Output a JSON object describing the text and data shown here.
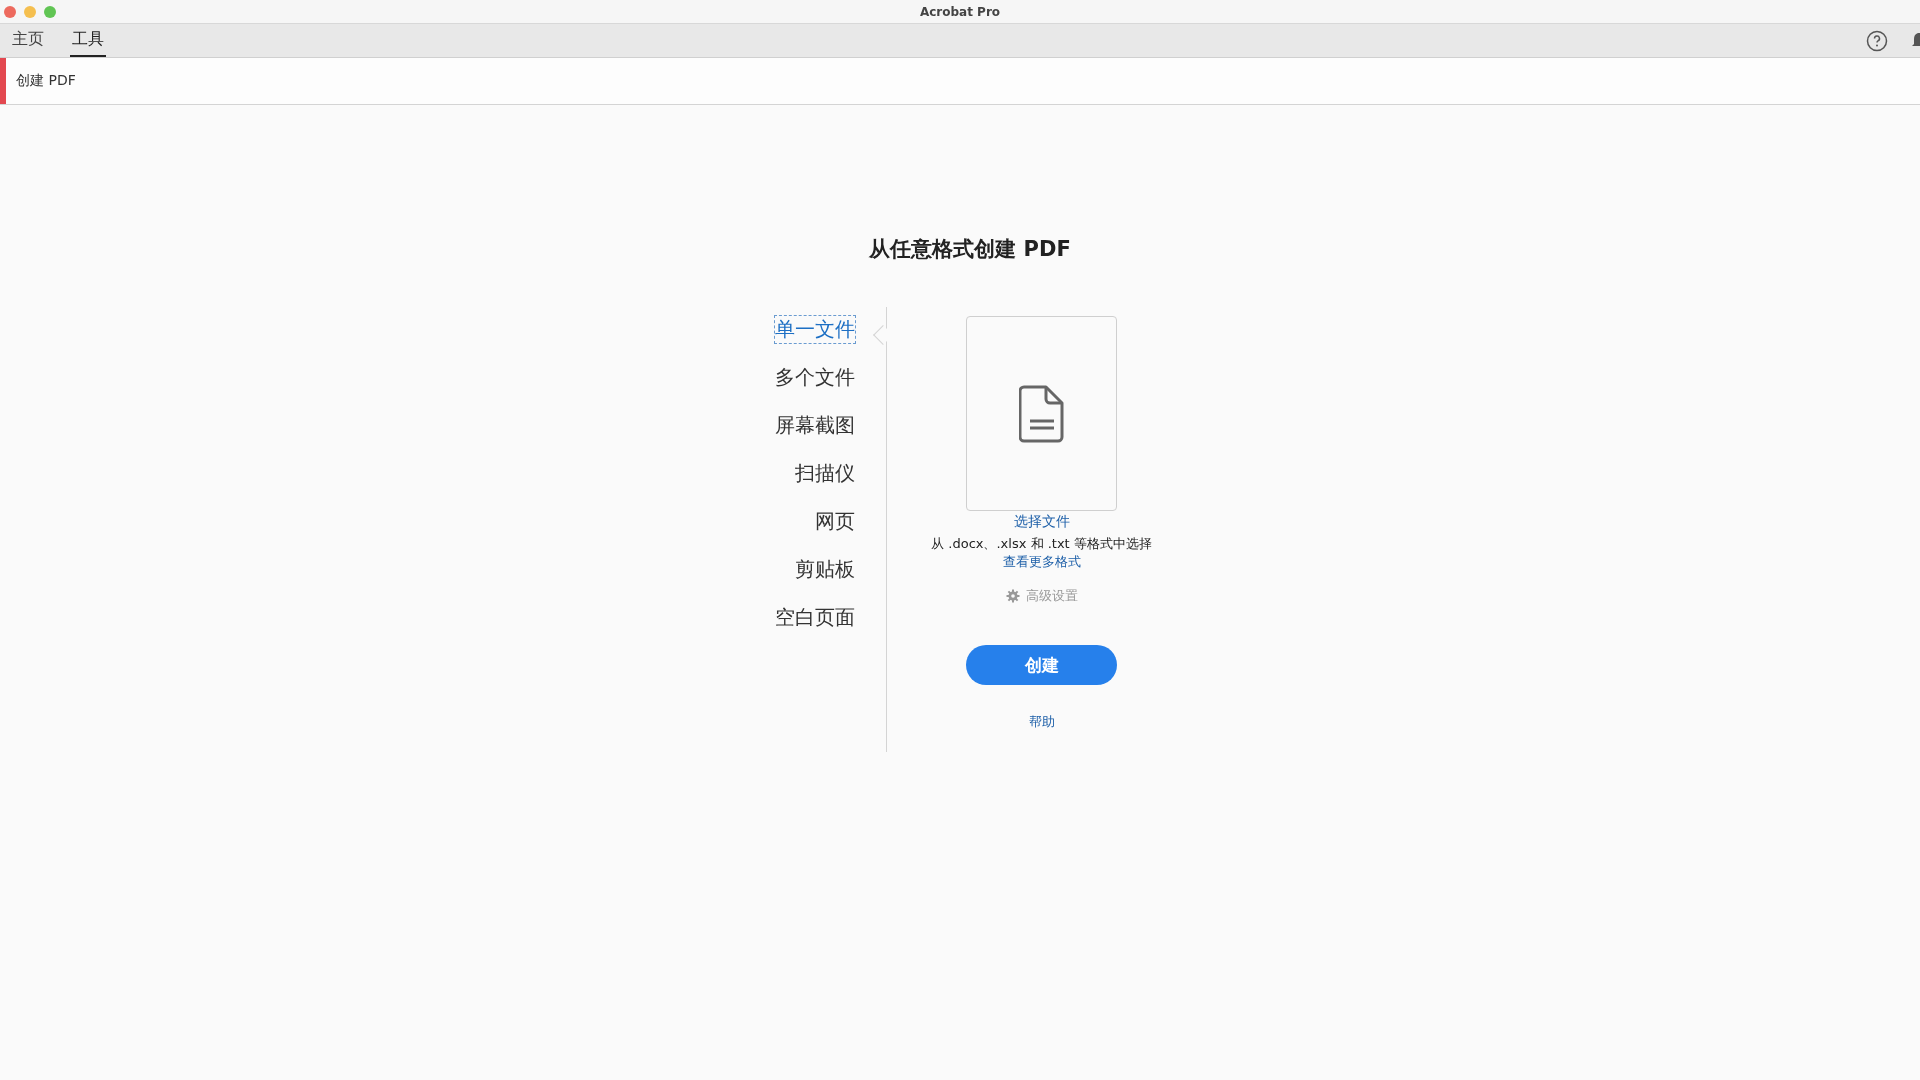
{
  "window": {
    "title": "Acrobat Pro"
  },
  "tabs": [
    {
      "label": "主页",
      "selected": false
    },
    {
      "label": "工具",
      "selected": true
    }
  ],
  "tool_bar": {
    "title": "创建 PDF"
  },
  "heading": "从任意格式创建 PDF",
  "sources": [
    {
      "label": "单一文件",
      "selected": true
    },
    {
      "label": "多个文件",
      "selected": false
    },
    {
      "label": "屏幕截图",
      "selected": false
    },
    {
      "label": "扫描仪",
      "selected": false
    },
    {
      "label": "网页",
      "selected": false
    },
    {
      "label": "剪贴板",
      "selected": false
    },
    {
      "label": "空白页面",
      "selected": false
    }
  ],
  "panel": {
    "choose_link": "选择文件",
    "description": "从 .docx、.xlsx 和 .txt 等格式中选择",
    "formats_link": "查看更多格式",
    "advanced": "高级设置",
    "create_button": "创建",
    "help_link": "帮助"
  }
}
